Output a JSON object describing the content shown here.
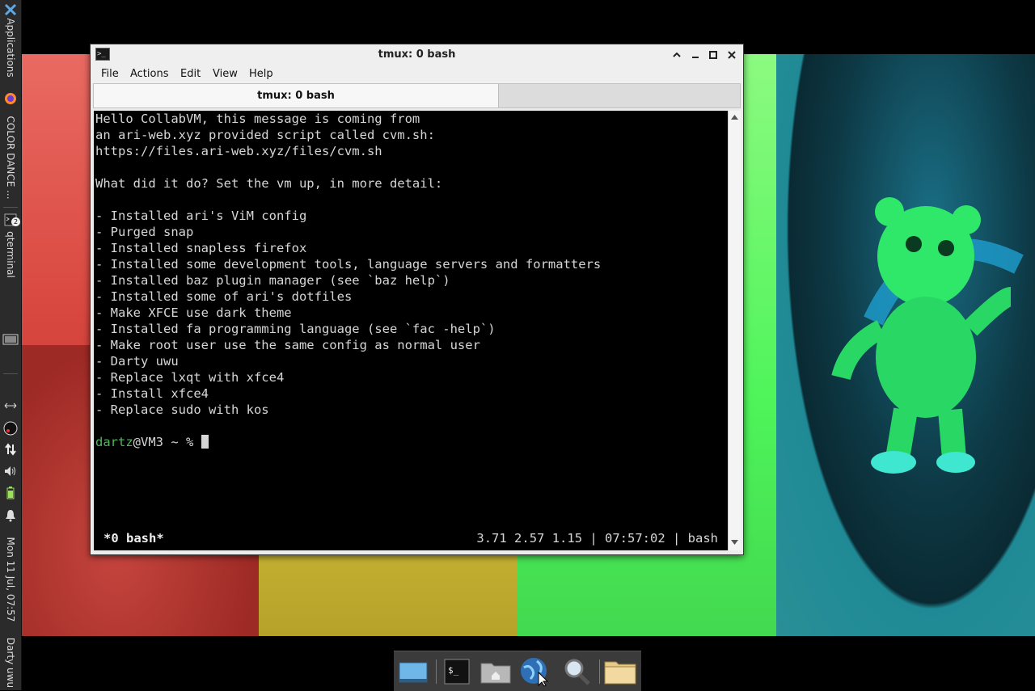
{
  "left_panel": {
    "applications_label": "Applications",
    "color_dance_label": "COLOR DANCE ...",
    "qterminal_label": "qterminal",
    "qterminal_badge": "2",
    "clock": "Mon 11 Jul, 07:57",
    "user_label": "Darty uwu"
  },
  "window": {
    "title": "tmux: 0 bash",
    "menu": [
      "File",
      "Actions",
      "Edit",
      "View",
      "Help"
    ],
    "tab_label": "tmux: 0 bash"
  },
  "terminal": {
    "lines": [
      "Hello CollabVM, this message is coming from",
      "an ari-web.xyz provided script called cvm.sh:",
      "https://files.ari-web.xyz/files/cvm.sh",
      "",
      "What did it do? Set the vm up, in more detail:",
      "",
      "- Installed ari's ViM config",
      "- Purged snap",
      "- Installed snapless firefox",
      "- Installed some development tools, language servers and formatters",
      "- Installed baz plugin manager (see `baz help`)",
      "- Installed some of ari's dotfiles",
      "- Make XFCE use dark theme",
      "- Installed fa programming language (see `fac -help`)",
      "- Make root user use the same config as normal user",
      "- Darty uwu",
      "- Replace lxqt with xfce4",
      "- Install xfce4",
      "- Replace sudo with kos"
    ],
    "prompt_user": "dartz",
    "prompt_rest": "@VM3 ~ % ",
    "status_left": "*0 bash*",
    "status_right": "3.71 2.57 1.15 | 07:57:02 | bash",
    "prompt_color": "#4fb85a"
  },
  "dock": {
    "items": [
      "show-desktop-icon",
      "terminal-icon",
      "home-folder-icon",
      "web-browser-icon",
      "search-icon",
      "file-manager-icon"
    ]
  }
}
